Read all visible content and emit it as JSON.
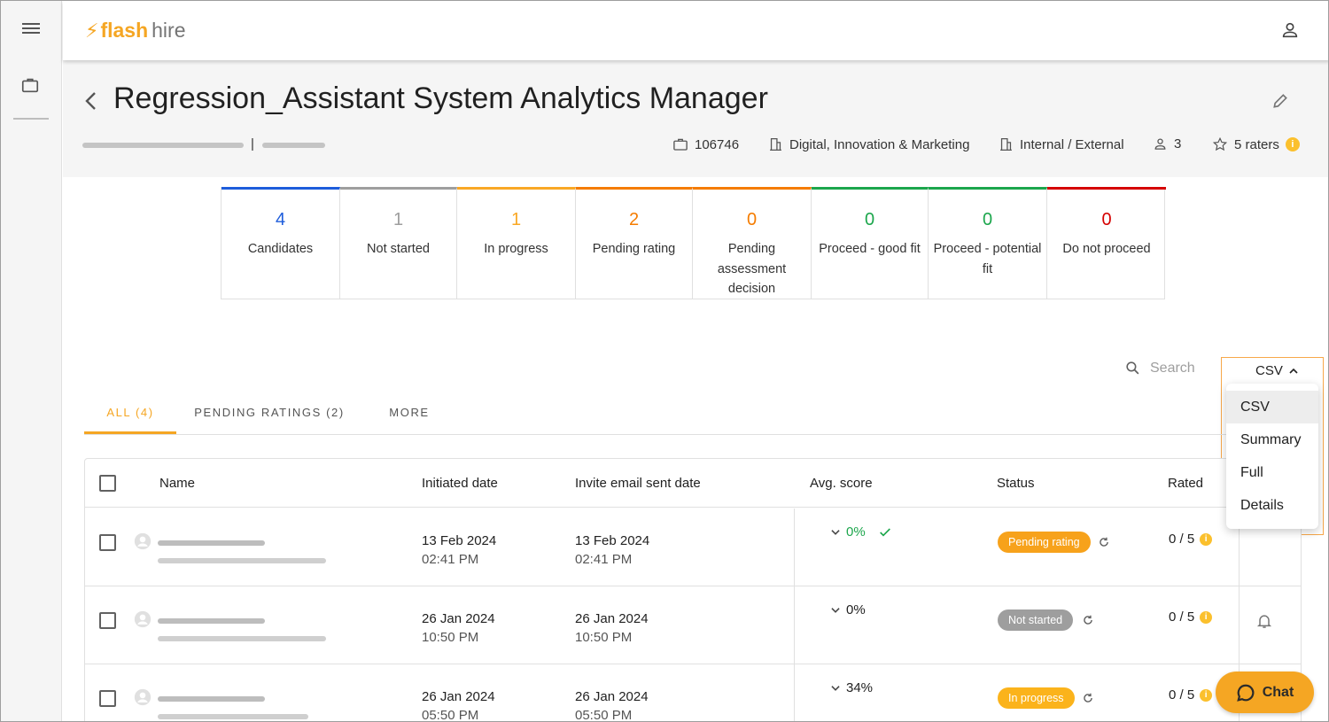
{
  "app": {
    "logo_flash": "flash",
    "logo_hire": "hire",
    "accent_color": "#f5a623"
  },
  "header": {
    "title": "Regression_Assistant System Analytics Manager",
    "separator": "|",
    "job_id": "106746",
    "department": "Digital, Innovation & Marketing",
    "visibility": "Internal / External",
    "headcount": "3",
    "raters": "5 raters",
    "info_glyph": "i"
  },
  "stats": [
    {
      "value": "4",
      "label": "Candidates",
      "color": "#1e5ddb"
    },
    {
      "value": "1",
      "label": "Not started",
      "color": "#9e9e9e"
    },
    {
      "value": "1",
      "label": "In progress",
      "color": "#f9a825"
    },
    {
      "value": "2",
      "label": "Pending rating",
      "color": "#f57c00"
    },
    {
      "value": "0",
      "label": "Pending assessment decision",
      "color": "#f57c00"
    },
    {
      "value": "0",
      "label": "Proceed - good fit",
      "color": "#1ca64c"
    },
    {
      "value": "0",
      "label": "Proceed - potential fit",
      "color": "#1ca64c"
    },
    {
      "value": "0",
      "label": "Do not proceed",
      "color": "#d50000"
    }
  ],
  "search": {
    "placeholder": "Search"
  },
  "export": {
    "selected": "CSV",
    "options": [
      "CSV",
      "Summary",
      "Full",
      "Details"
    ]
  },
  "tabs": [
    "ALL (4)",
    "PENDING RATINGS (2)",
    "MORE"
  ],
  "table": {
    "headers": {
      "name": "Name",
      "initiated": "Initiated date",
      "invite": "Invite email sent date",
      "score": "Avg. score",
      "status": "Status",
      "rated": "Rated"
    },
    "rows": [
      {
        "initiated_date": "13 Feb 2024",
        "initiated_time": "02:41 PM",
        "invite_date": "13 Feb 2024",
        "invite_time": "02:41 PM",
        "score": "0%",
        "score_color": "#1ca64c",
        "status": "Pending rating",
        "status_color": "#f7a21b",
        "rated": "0 / 5"
      },
      {
        "initiated_date": "26 Jan 2024",
        "initiated_time": "10:50 PM",
        "invite_date": "26 Jan 2024",
        "invite_time": "10:50 PM",
        "score": "0%",
        "score_color": "#212121",
        "status": "Not started",
        "status_color": "#9e9e9e",
        "rated": "0 / 5"
      },
      {
        "initiated_date": "26 Jan 2024",
        "initiated_time": "05:50 PM",
        "invite_date": "26 Jan 2024",
        "invite_time": "05:50 PM",
        "score": "34%",
        "score_color": "#212121",
        "status": "In progress",
        "status_color": "#fbb31b",
        "rated": "0 / 5"
      }
    ]
  },
  "chat": {
    "label": "Chat"
  }
}
